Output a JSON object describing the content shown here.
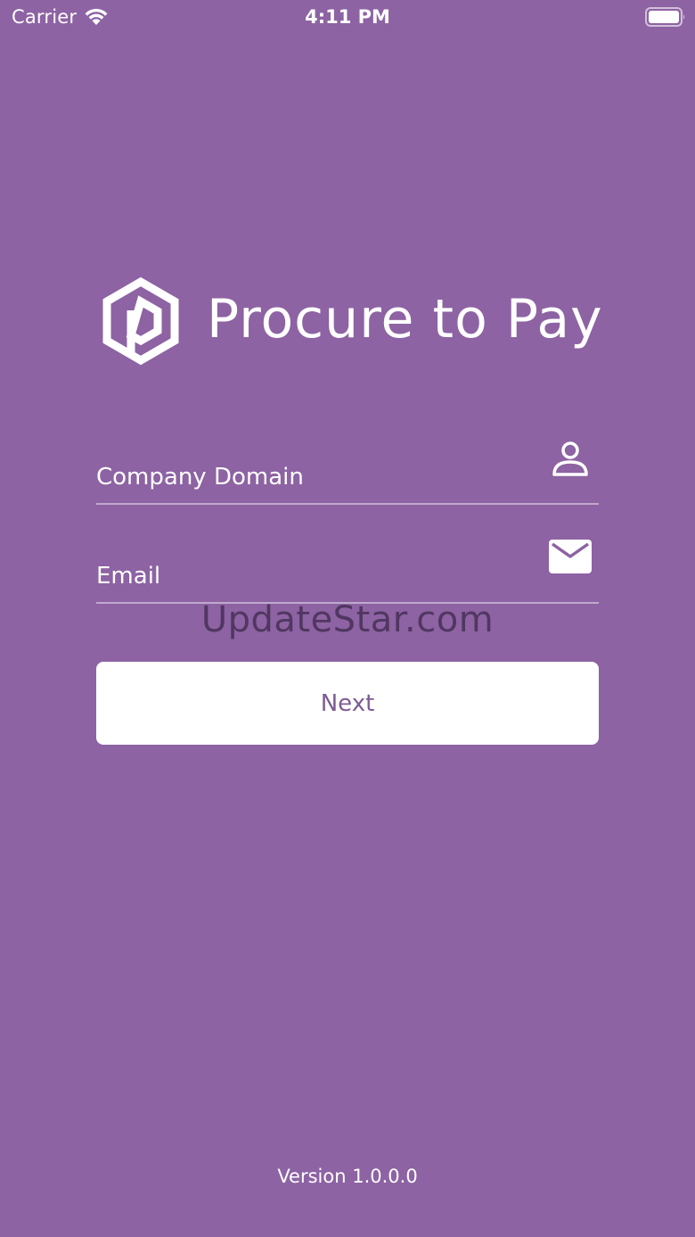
{
  "status_bar": {
    "carrier": "Carrier",
    "time": "4:11 PM",
    "wifi_icon": "wifi-icon",
    "battery_icon": "battery-icon"
  },
  "logo": {
    "text": "Procure to Pay",
    "mark_icon": "hexagon-p-logo"
  },
  "form": {
    "company_domain": {
      "placeholder": "Company Domain",
      "value": "",
      "icon": "user-icon"
    },
    "email": {
      "placeholder": "Email",
      "value": "",
      "icon": "envelope-icon"
    },
    "next_label": "Next"
  },
  "watermark": "UpdateStar.com",
  "footer": {
    "version": "Version 1.0.0.0"
  },
  "colors": {
    "background": "#8d63a3",
    "button_text": "#7d5b93",
    "foreground": "#ffffff"
  }
}
